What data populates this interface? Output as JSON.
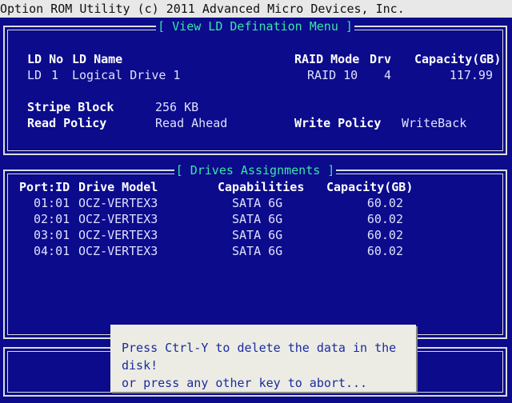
{
  "header": {
    "title": "Option ROM Utility (c) 2011 Advanced Micro Devices, Inc."
  },
  "ld_panel": {
    "title": "[ View LD Defination Menu ]",
    "columns": {
      "ld_no": "LD No",
      "ld_name": "LD Name",
      "raid_mode": "RAID Mode",
      "drv": "Drv",
      "capacity": "Capacity(GB)"
    },
    "row": {
      "ld_prefix": "LD",
      "ld_no": "1",
      "ld_name": "Logical Drive 1",
      "raid_mode": "RAID 10",
      "drv": "4",
      "capacity": "117.99"
    },
    "stripe_block_label": "Stripe Block",
    "stripe_block_value": "256 KB",
    "read_policy_label": "Read Policy",
    "read_policy_value": "Read Ahead",
    "write_policy_label": "Write Policy",
    "write_policy_value": "WriteBack"
  },
  "drives_panel": {
    "title": "[ Drives Assignments ]",
    "columns": {
      "port": "Port:ID",
      "model": "Drive Model",
      "capabilities": "Capabilities",
      "capacity": "Capacity(GB)"
    },
    "rows": [
      {
        "port": "01:01",
        "model": "OCZ-VERTEX3",
        "capabilities": "SATA 6G",
        "capacity": "60.02"
      },
      {
        "port": "02:01",
        "model": "OCZ-VERTEX3",
        "capabilities": "SATA 6G",
        "capacity": "60.02"
      },
      {
        "port": "03:01",
        "model": "OCZ-VERTEX3",
        "capabilities": "SATA 6G",
        "capacity": "60.02"
      },
      {
        "port": "04:01",
        "model": "OCZ-VERTEX3",
        "capabilities": "SATA 6G",
        "capacity": "60.02"
      }
    ]
  },
  "dialog": {
    "line1": "Press Ctrl-Y to delete the data in the disk!",
    "line2": "or press any other key to abort..."
  }
}
